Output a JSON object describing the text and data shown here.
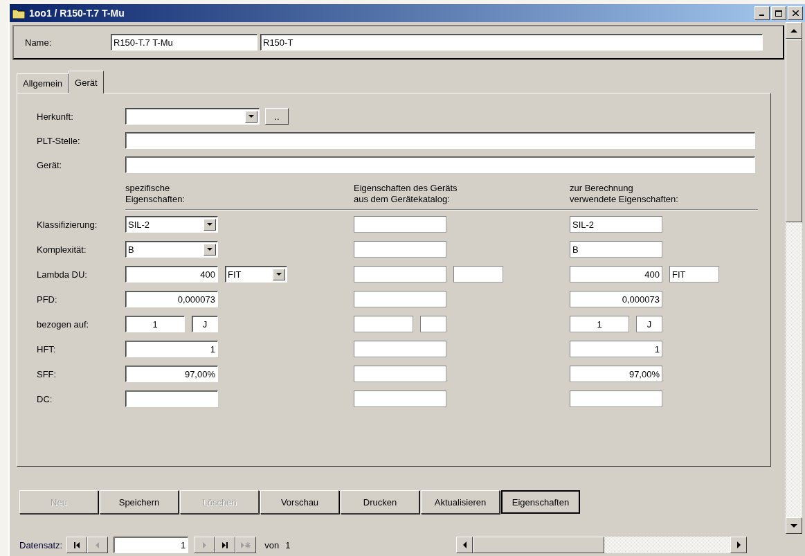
{
  "window": {
    "title": "1oo1 / R150-T.7 T-Mu"
  },
  "name_row": {
    "label": "Name:",
    "values": [
      "R150-T.7 T-Mu",
      "R150-T"
    ]
  },
  "tabs": [
    {
      "label": "Allgemein",
      "selected": false
    },
    {
      "label": "Gerät",
      "selected": true
    }
  ],
  "top_fields": [
    {
      "label": "Herkunft:",
      "kind": "combo",
      "button": ".."
    },
    {
      "label": "PLT-Stelle:",
      "kind": "text"
    },
    {
      "label": "Gerät:",
      "kind": "text"
    }
  ],
  "column_headers": [
    "spezifische\nEigenschaften:",
    "Eigenschaften des  Geräts\naus dem Gerätekatalog:",
    "zur Berechnung\nverwendete Eigenschaften:"
  ],
  "properties": [
    {
      "label": "Klassifizierung:",
      "cells": [
        {
          "kind": "combo",
          "value": "SIL-2"
        },
        {
          "kind": "text"
        },
        {
          "kind": "text",
          "value": "SIL-2"
        }
      ]
    },
    {
      "label": "Komplexität:",
      "cells": [
        {
          "kind": "combo",
          "value": "B"
        },
        {
          "kind": "text"
        },
        {
          "kind": "text",
          "value": "B"
        }
      ]
    },
    {
      "label": "Lambda DU:",
      "cells": [
        {
          "kind": "value-unit-combo",
          "value": "400",
          "unit": "FIT"
        },
        {
          "kind": "value-unit"
        },
        {
          "kind": "value-unit",
          "value": "400",
          "unit": "FIT"
        }
      ]
    },
    {
      "label": "PFD:",
      "cells": [
        {
          "kind": "number",
          "value": "0,000073"
        },
        {
          "kind": "number"
        },
        {
          "kind": "number",
          "value": "0,000073"
        }
      ]
    },
    {
      "label": "bezogen auf:",
      "cells": [
        {
          "kind": "pair",
          "value": "1",
          "unit": "J"
        },
        {
          "kind": "pair"
        },
        {
          "kind": "pair",
          "value": "1",
          "unit": "J"
        }
      ]
    },
    {
      "label": "HFT:",
      "cells": [
        {
          "kind": "number",
          "value": "1"
        },
        {
          "kind": "number"
        },
        {
          "kind": "number",
          "value": "1"
        }
      ]
    },
    {
      "label": "SFF:",
      "cells": [
        {
          "kind": "number",
          "value": "97,00%"
        },
        {
          "kind": "number"
        },
        {
          "kind": "number",
          "value": "97,00%"
        }
      ]
    },
    {
      "label": "DC:",
      "cells": [
        {
          "kind": "number"
        },
        {
          "kind": "number"
        },
        {
          "kind": "number"
        }
      ]
    }
  ],
  "buttons": [
    {
      "label": "Neu",
      "disabled": true,
      "default": false
    },
    {
      "label": "Speichern",
      "disabled": false,
      "default": false
    },
    {
      "label": "Löschen",
      "disabled": true,
      "default": false
    },
    {
      "label": "Vorschau",
      "disabled": false,
      "default": false
    },
    {
      "label": "Drucken",
      "disabled": false,
      "default": false
    },
    {
      "label": "Aktualisieren",
      "disabled": false,
      "default": false
    },
    {
      "label": "Eigenschaften",
      "disabled": false,
      "default": true
    }
  ],
  "navigation": {
    "label": "Datensatz:",
    "record": "1",
    "of_label": "von",
    "total": "1",
    "buttons_before": [
      {
        "kind": "first",
        "disabled": false
      },
      {
        "kind": "previous",
        "disabled": true
      }
    ],
    "buttons_after": [
      {
        "kind": "next",
        "disabled": true
      },
      {
        "kind": "last",
        "disabled": false
      },
      {
        "kind": "new",
        "disabled": true
      }
    ]
  }
}
